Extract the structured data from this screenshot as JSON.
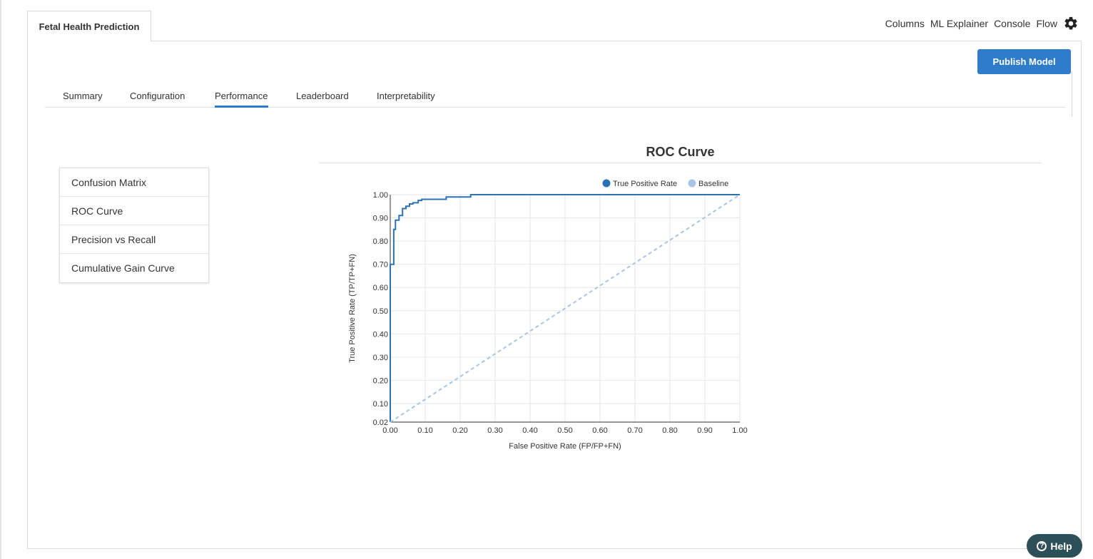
{
  "document_tab": {
    "title": "Fetal Health Prediction"
  },
  "top_nav": {
    "links": [
      "Columns",
      "ML Explainer",
      "Console",
      "Flow"
    ],
    "settings_icon": "gear-icon"
  },
  "toolbar": {
    "publish_label": "Publish Model"
  },
  "tabs": [
    {
      "label": "Summary"
    },
    {
      "label": "Configuration"
    },
    {
      "label": "Performance",
      "active": true
    },
    {
      "label": "Leaderboard"
    },
    {
      "label": "Interpretability"
    }
  ],
  "side_menu": {
    "items": [
      {
        "label": "Confusion Matrix"
      },
      {
        "label": "ROC Curve",
        "selected": true
      },
      {
        "label": "Precision vs Recall"
      },
      {
        "label": "Cumulative Gain Curve"
      }
    ]
  },
  "chart_section": {
    "title": "ROC Curve"
  },
  "help": {
    "label": "Help",
    "icon": "question-icon"
  },
  "colors": {
    "accent": "#2f7ccb",
    "tpr_series": "#2b72b5",
    "baseline_series": "#a9c4e6",
    "help_bg": "#2d4f57"
  },
  "chart_data": {
    "type": "line",
    "xlabel": "False Positive Rate (FP/FP+FN)",
    "ylabel": "True Positive Rate (TP/TP+FN)",
    "xlim": [
      0,
      1
    ],
    "ylim": [
      0.02,
      1
    ],
    "x_ticks": [
      "0.00",
      "0.10",
      "0.20",
      "0.30",
      "0.40",
      "0.50",
      "0.60",
      "0.70",
      "0.80",
      "0.90",
      "1.00"
    ],
    "y_ticks": [
      "0.02",
      "0.10",
      "0.20",
      "0.30",
      "0.40",
      "0.50",
      "0.60",
      "0.70",
      "0.80",
      "0.90",
      "1.00"
    ],
    "grid": true,
    "legend_position": "top-right",
    "series": [
      {
        "name": "True Positive Rate",
        "style": "solid",
        "x": [
          0.0,
          0.0,
          0.01,
          0.01,
          0.015,
          0.015,
          0.025,
          0.025,
          0.035,
          0.035,
          0.045,
          0.045,
          0.055,
          0.055,
          0.065,
          0.065,
          0.08,
          0.08,
          0.09,
          0.09,
          0.16,
          0.16,
          0.23,
          0.23,
          1.0
        ],
        "y": [
          0.02,
          0.7,
          0.7,
          0.85,
          0.85,
          0.89,
          0.89,
          0.91,
          0.91,
          0.94,
          0.94,
          0.95,
          0.95,
          0.96,
          0.96,
          0.965,
          0.965,
          0.975,
          0.975,
          0.98,
          0.98,
          0.99,
          0.99,
          1.0,
          1.0
        ]
      },
      {
        "name": "Baseline",
        "style": "dashed",
        "x": [
          0.0,
          1.0
        ],
        "y": [
          0.02,
          1.0
        ]
      }
    ]
  }
}
